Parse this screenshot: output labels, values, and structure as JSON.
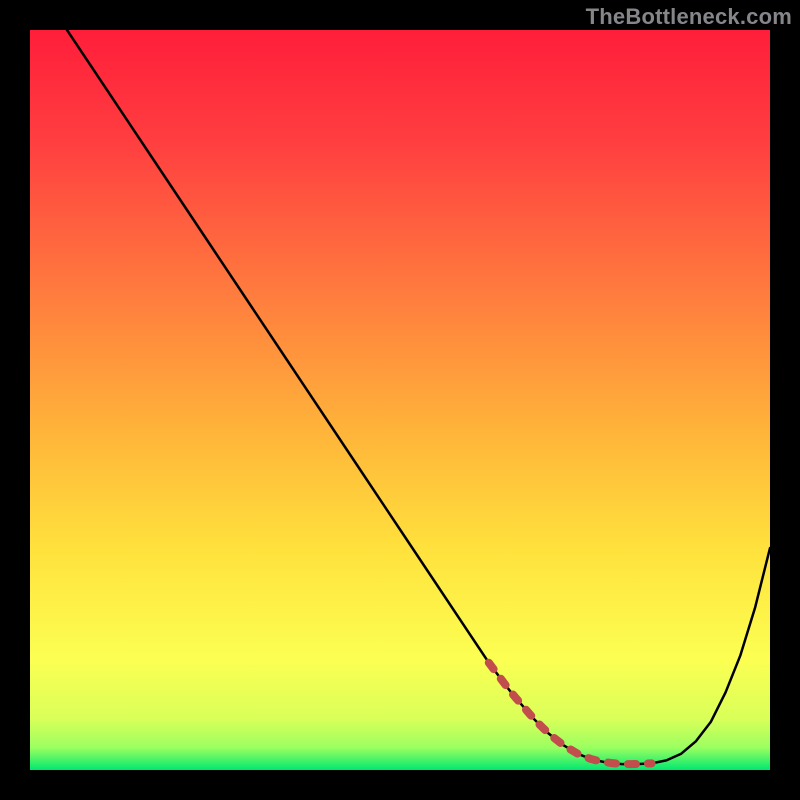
{
  "watermark": "TheBottleneck.com",
  "gradient_stops": [
    {
      "offset": 0.0,
      "color": "#ff1e3a"
    },
    {
      "offset": 0.15,
      "color": "#ff3e40"
    },
    {
      "offset": 0.35,
      "color": "#ff7a3e"
    },
    {
      "offset": 0.55,
      "color": "#ffb63a"
    },
    {
      "offset": 0.7,
      "color": "#ffe13c"
    },
    {
      "offset": 0.85,
      "color": "#fcff52"
    },
    {
      "offset": 0.93,
      "color": "#daff59"
    },
    {
      "offset": 0.97,
      "color": "#9aff60"
    },
    {
      "offset": 1.0,
      "color": "#00e870"
    }
  ],
  "chart_data": {
    "type": "line",
    "title": "",
    "xlabel": "",
    "ylabel": "",
    "xlim": [
      0,
      100
    ],
    "ylim": [
      0,
      100
    ],
    "grid": false,
    "legend": false,
    "series": [
      {
        "name": "curve",
        "stroke": "#000000",
        "x": [
          5,
          10,
          15,
          20,
          25,
          30,
          35,
          40,
          45,
          50,
          55,
          60,
          62,
          65,
          68,
          70,
          72,
          74,
          76,
          78,
          80,
          82,
          84,
          86,
          88,
          90,
          92,
          94,
          96,
          98,
          100
        ],
        "values": [
          100,
          92.5,
          85,
          77.5,
          70,
          62.5,
          55,
          47.5,
          40,
          32.5,
          25,
          17.5,
          14.5,
          10.5,
          7.0,
          5.0,
          3.4,
          2.2,
          1.4,
          1.0,
          0.8,
          0.8,
          0.9,
          1.3,
          2.2,
          3.9,
          6.5,
          10.5,
          15.5,
          22,
          30
        ]
      }
    ],
    "flat_zone": {
      "stroke": "#c14d4d",
      "x_from": 62,
      "x_to": 84
    }
  }
}
